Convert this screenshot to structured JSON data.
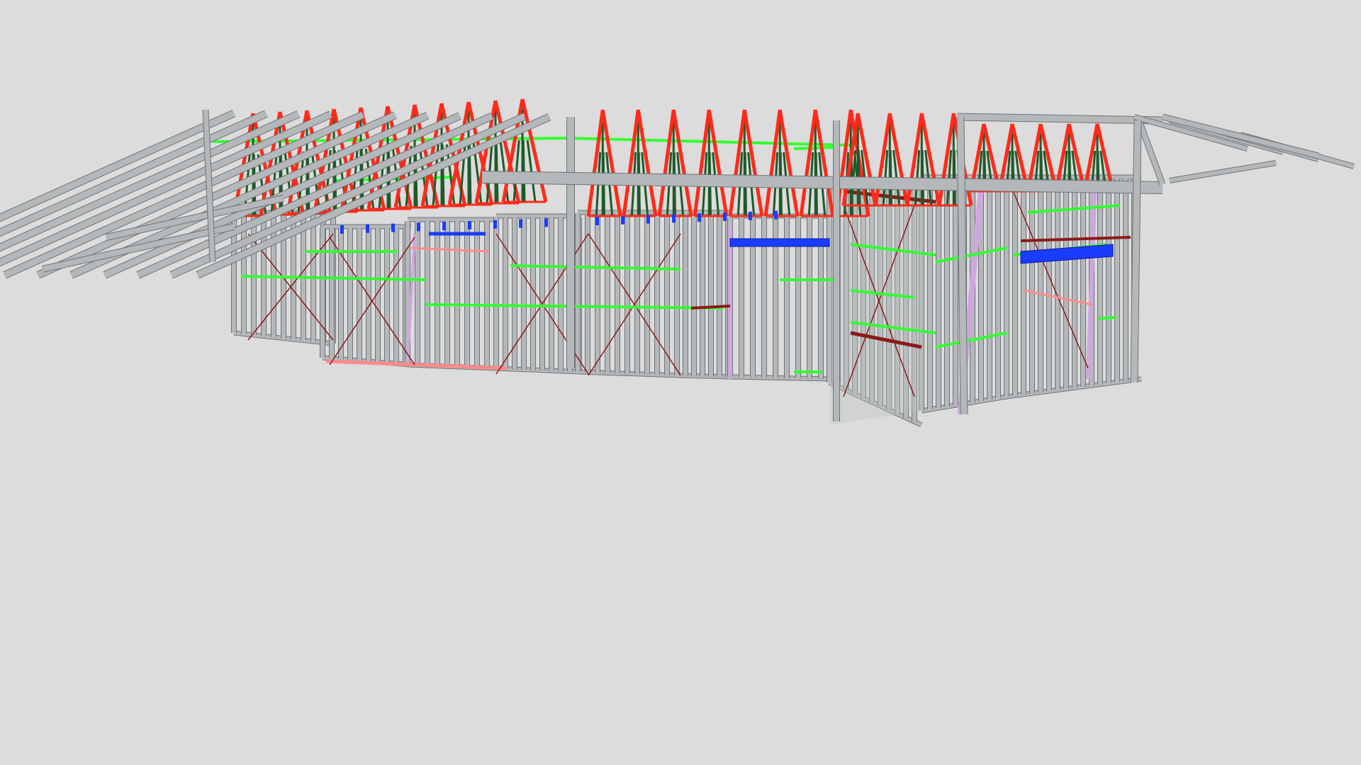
{
  "viewer": {
    "background_color": "#dcdcdc",
    "model": "steel-frame-house"
  },
  "palette": {
    "frame_member": "#b4b8ba",
    "frame_member_dark": "#8e9294",
    "frame_edge": "#6f7375",
    "truss_chord": "#ff2a1a",
    "truss_web": "#1e5a2a",
    "nogging": "#33ff33",
    "lintel": "#1a3cff",
    "bracing": "#8a1a1a",
    "bottom_plate_highlight": "#ff8a8a",
    "post_highlight": "#cfa6e0"
  },
  "icons": {
    "scene": "3d-frame-model"
  }
}
